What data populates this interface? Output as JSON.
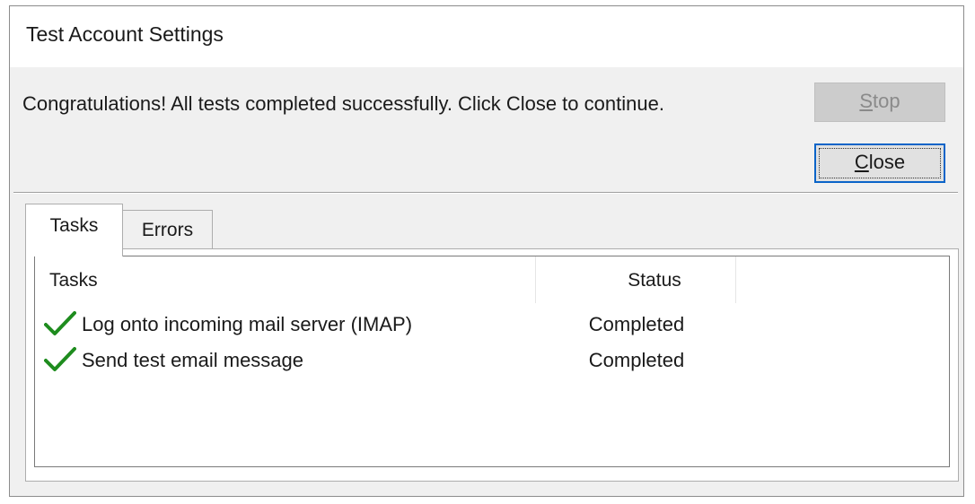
{
  "window": {
    "title": "Test Account Settings"
  },
  "message": "Congratulations! All tests completed successfully. Click Close to continue.",
  "buttons": {
    "stop": {
      "label": "Stop",
      "enabled": false
    },
    "close": {
      "label": "Close",
      "enabled": true,
      "focused": true
    }
  },
  "tabs": [
    {
      "label": "Tasks",
      "active": true
    },
    {
      "label": "Errors",
      "active": false
    }
  ],
  "table": {
    "columns": [
      "Tasks",
      "Status"
    ],
    "rows": [
      {
        "icon": "checkmark-icon",
        "task": "Log onto incoming mail server (IMAP)",
        "status": "Completed"
      },
      {
        "icon": "checkmark-icon",
        "task": "Send test email message",
        "status": "Completed"
      }
    ]
  },
  "colors": {
    "success_check": "#1e8c1e",
    "focus_border": "#0a64c8"
  }
}
